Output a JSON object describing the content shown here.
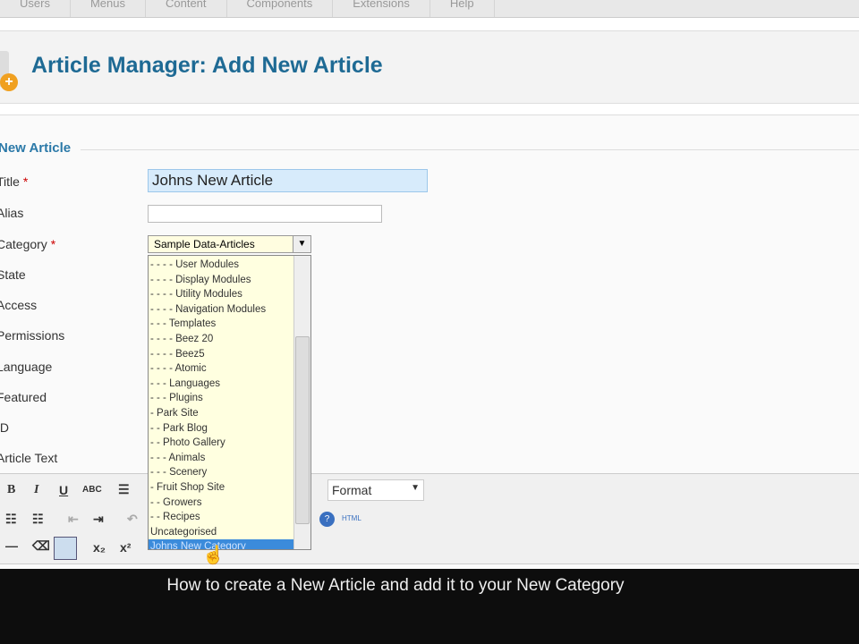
{
  "menu": [
    "Users",
    "Menus",
    "Content",
    "Components",
    "Extensions",
    "Help"
  ],
  "header": {
    "title": "Article Manager: Add New Article"
  },
  "form": {
    "legend": "New Article",
    "labels": [
      "Title",
      "Alias",
      "Category",
      "State",
      "Access",
      "Permissions",
      "Language",
      "Featured",
      "ID",
      "Article Text"
    ],
    "required_mark": "*",
    "title_value": "Johns New Article",
    "alias_value": "",
    "category_selected": "Sample Data-Articles"
  },
  "dropdown_options": [
    "- - - - User Modules",
    "- - - - Display Modules",
    "- - - - Utility Modules",
    "- - - - Navigation Modules",
    "- - - Templates",
    "- - - - Beez 20",
    "- - - - Beez5",
    "- - - - Atomic",
    "- - - Languages",
    "- - - Plugins",
    "- Park Site",
    "- - Park Blog",
    "- - Photo Gallery",
    "- - - Animals",
    "- - - Scenery",
    "- Fruit Shop Site",
    "- - Growers",
    "- - Recipes",
    "Uncategorised",
    "Johns New Category"
  ],
  "highlighted_option": "Johns New Category",
  "editor": {
    "format_label": "Format",
    "html_label": "HTML",
    "bold": "B",
    "italic": "I",
    "underline": "U",
    "strike": "ABC",
    "sub": "x₂",
    "sup": "x²"
  },
  "caption": "How to create a New Article and add it to your New Category"
}
